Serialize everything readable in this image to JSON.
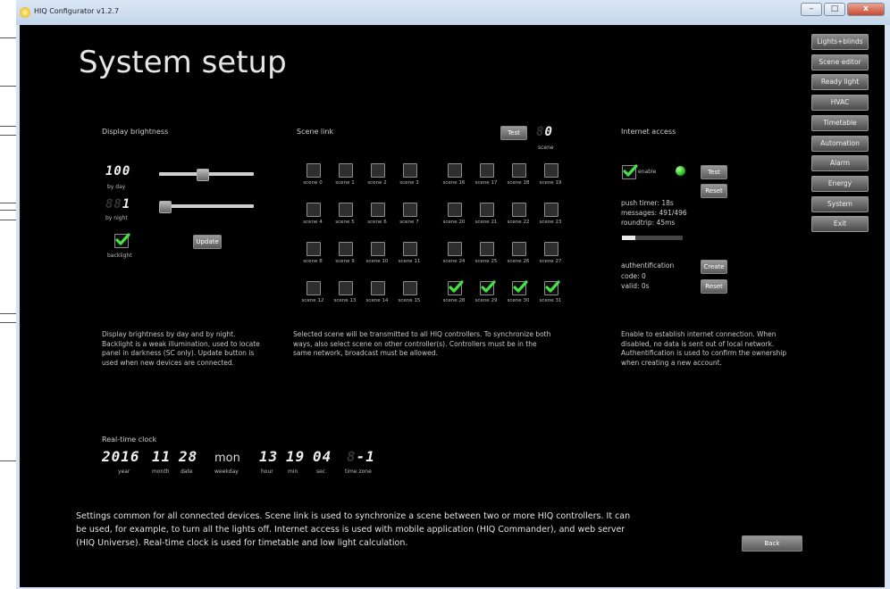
{
  "window": {
    "title": "HIQ Configurator v1.2.7",
    "controls": [
      "–",
      "□",
      "x"
    ]
  },
  "page": {
    "title": "System setup"
  },
  "nav": [
    "Lights+blinds",
    "Scene editor",
    "Ready light",
    "HVAC",
    "Timetable",
    "Automation",
    "Alarm",
    "Energy",
    "System",
    "Exit"
  ],
  "brightness": {
    "title": "Display brightness",
    "day_value": "100",
    "day_label": "by day",
    "day_level": 0.45,
    "night_value": "1",
    "night_label": "by night",
    "night_level": 0.0,
    "backlight_label": "backlight",
    "backlight_checked": true,
    "update_button": "Update",
    "description": "Display brightness by day and by night. Backlight is a weak illumination, used to locate panel in darkness (SC only). Update button is used when new devices are connected."
  },
  "scene_link": {
    "title": "Scene link",
    "test_button": "Test",
    "scene_value": "0",
    "scene_caption": "scene",
    "scenes": [
      {
        "label": "scene 0",
        "checked": false
      },
      {
        "label": "scene 1",
        "checked": false
      },
      {
        "label": "scene 2",
        "checked": false
      },
      {
        "label": "scene 3",
        "checked": false
      },
      {
        "label": "scene 16",
        "checked": false
      },
      {
        "label": "scene 17",
        "checked": false
      },
      {
        "label": "scene 18",
        "checked": false
      },
      {
        "label": "scene 19",
        "checked": false
      },
      {
        "label": "scene 4",
        "checked": false
      },
      {
        "label": "scene 5",
        "checked": false
      },
      {
        "label": "scene 6",
        "checked": false
      },
      {
        "label": "scene 7",
        "checked": false
      },
      {
        "label": "scene 20",
        "checked": false
      },
      {
        "label": "scene 21",
        "checked": false
      },
      {
        "label": "scene 22",
        "checked": false
      },
      {
        "label": "scene 23",
        "checked": false
      },
      {
        "label": "scene 8",
        "checked": false
      },
      {
        "label": "scene 9",
        "checked": false
      },
      {
        "label": "scene 10",
        "checked": false
      },
      {
        "label": "scene 11",
        "checked": false
      },
      {
        "label": "scene 24",
        "checked": false
      },
      {
        "label": "scene 25",
        "checked": false
      },
      {
        "label": "scene 26",
        "checked": false
      },
      {
        "label": "scene 27",
        "checked": false
      },
      {
        "label": "scene 12",
        "checked": false
      },
      {
        "label": "scene 13",
        "checked": false
      },
      {
        "label": "scene 14",
        "checked": false
      },
      {
        "label": "scene 15",
        "checked": false
      },
      {
        "label": "scene 28",
        "checked": true
      },
      {
        "label": "scene 29",
        "checked": true
      },
      {
        "label": "scene 30",
        "checked": true
      },
      {
        "label": "scene 31",
        "checked": true
      }
    ],
    "description": "Selected scene will be transmitted to all HIQ controllers. To synchronize both ways, also select scene on other controller(s). Controllers must be in the same network, broadcast must be allowed."
  },
  "internet": {
    "title": "Internet access",
    "enable_label": "enable",
    "enable_checked": true,
    "status_color": "#1fbf1f",
    "test_button": "Test",
    "reset_button": "Reset",
    "push_timer": "push timer: 18s",
    "messages": "messages: 491/496",
    "roundtrip": "roundtrip: 45ms",
    "roundtrip_level": 0.22,
    "auth_label": "authentification",
    "create_button": "Create",
    "code": "code: 0",
    "valid": "valid: 0s",
    "auth_reset_button": "Reset",
    "description": "Enable to establish internet connection. When disabled, no data is sent out of local network. Authentification is used to confirm the ownership when creating a new account."
  },
  "clock": {
    "title": "Real-time clock",
    "year": "2016",
    "year_label": "year",
    "month": "11",
    "month_label": "month",
    "date": "28",
    "date_label": "date",
    "weekday": "mon",
    "weekday_label": "weekday",
    "hour": "13",
    "hour_label": "hour",
    "min": "19",
    "min_label": "min",
    "sec": "04",
    "sec_label": "sec",
    "tz": "-1",
    "tz_label": "time zone"
  },
  "footer": "Settings common for all connected devices. Scene link is used to synchronize a scene between two or more HIQ controllers. It can be used, for example, to turn all the lights off. Internet access is used with mobile application (HIQ Commander), and web server (HIQ Universe). Real-time clock is used for timetable and low light calculation.",
  "back_button": "Back"
}
